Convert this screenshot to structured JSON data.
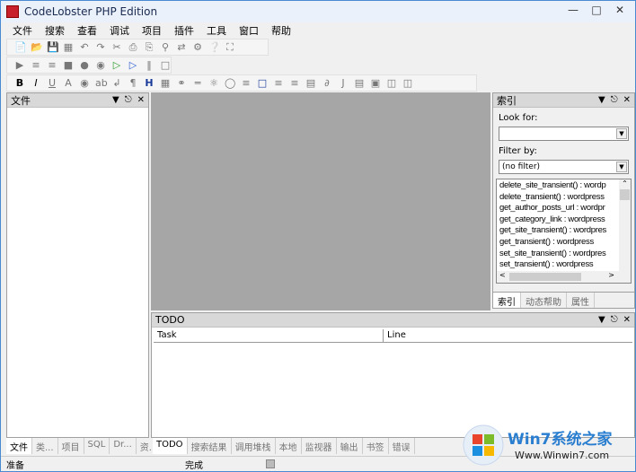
{
  "window": {
    "title": "CodeLobster PHP Edition"
  },
  "menu": [
    "文件",
    "搜索",
    "查看",
    "调试",
    "项目",
    "插件",
    "工具",
    "窗口",
    "帮助"
  ],
  "left_panel": {
    "title": "文件",
    "tabs": [
      "文件",
      "类...",
      "项目",
      "SQL",
      "Dr...",
      "资..."
    ]
  },
  "right_panel": {
    "title": "索引",
    "look_for_label": "Look for:",
    "look_for_value": "",
    "filter_label": "Filter by:",
    "filter_value": "(no filter)",
    "items": [
      "delete_site_transient() : wordp",
      "delete_transient() : wordpress",
      "get_author_posts_url : wordpr",
      "get_category_link : wordpress",
      "get_site_transient() : wordpres",
      "get_transient() : wordpress",
      "set_site_transient() : wordpres",
      "set_transient() : wordpress"
    ],
    "tabs": [
      "索引",
      "动态帮助",
      "属性"
    ]
  },
  "todo_panel": {
    "title": "TODO",
    "columns": [
      "Task",
      "Line"
    ],
    "tabs": [
      "TODO",
      "搜索结果",
      "调用堆栈",
      "本地",
      "监视器",
      "输出",
      "书签",
      "错误"
    ]
  },
  "status": {
    "left": "准备",
    "middle": "完成"
  },
  "watermark": {
    "brand": "Win7系统之家",
    "url": "Www.Winwin7.com"
  }
}
